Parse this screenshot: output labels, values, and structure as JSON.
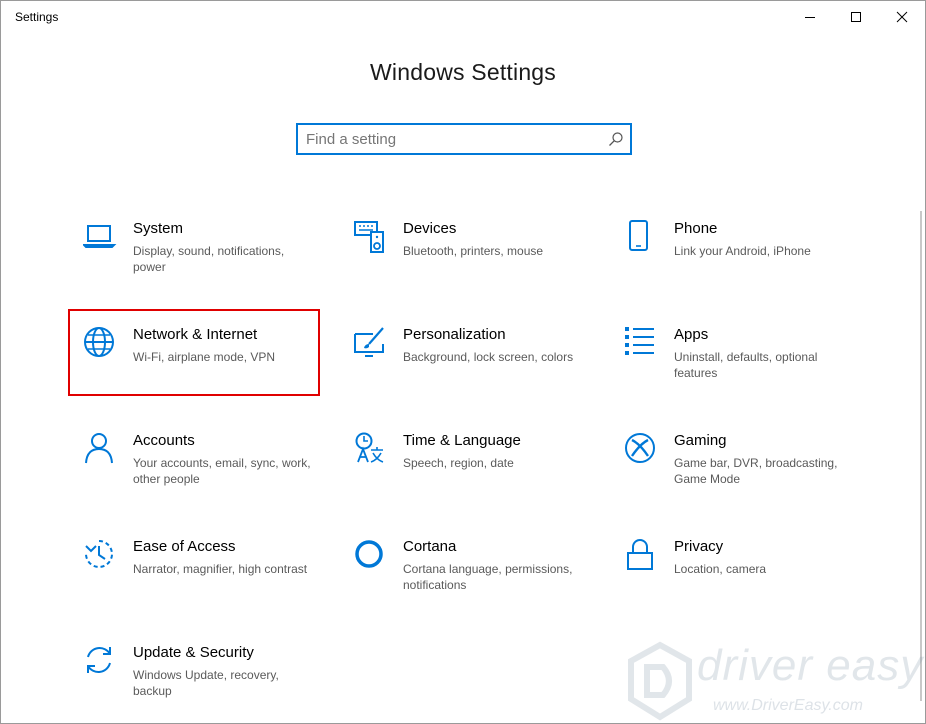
{
  "window": {
    "title": "Settings",
    "controls": {
      "minimize": "minimize-icon",
      "maximize": "maximize-icon",
      "close": "close-icon"
    }
  },
  "heading": "Windows Settings",
  "search": {
    "placeholder": "Find a setting",
    "value": "",
    "icon": "search-icon"
  },
  "accent_color": "#0078d7",
  "highlight_color": "#e00000",
  "tiles": [
    {
      "title": "System",
      "desc": "Display, sound, notifications, power",
      "icon": "laptop-icon"
    },
    {
      "title": "Devices",
      "desc": "Bluetooth, printers, mouse",
      "icon": "keyboard-speaker-icon"
    },
    {
      "title": "Phone",
      "desc": "Link your Android, iPhone",
      "icon": "phone-icon"
    },
    {
      "title": "Network & Internet",
      "desc": "Wi-Fi, airplane mode, VPN",
      "icon": "globe-icon",
      "highlighted": true
    },
    {
      "title": "Personalization",
      "desc": "Background, lock screen, colors",
      "icon": "paint-icon"
    },
    {
      "title": "Apps",
      "desc": "Uninstall, defaults, optional features",
      "icon": "apps-list-icon"
    },
    {
      "title": "Accounts",
      "desc": "Your accounts, email, sync, work, other people",
      "icon": "person-icon"
    },
    {
      "title": "Time & Language",
      "desc": "Speech, region, date",
      "icon": "time-language-icon"
    },
    {
      "title": "Gaming",
      "desc": "Game bar, DVR, broadcasting, Game Mode",
      "icon": "xbox-icon"
    },
    {
      "title": "Ease of Access",
      "desc": "Narrator, magnifier, high contrast",
      "icon": "ease-of-access-icon"
    },
    {
      "title": "Cortana",
      "desc": "Cortana language, permissions, notifications",
      "icon": "cortana-icon"
    },
    {
      "title": "Privacy",
      "desc": "Location, camera",
      "icon": "lock-icon"
    },
    {
      "title": "Update & Security",
      "desc": "Windows Update, recovery, backup",
      "icon": "update-icon"
    }
  ],
  "watermark": {
    "text": "driver easy",
    "url": "www.DriverEasy.com"
  }
}
